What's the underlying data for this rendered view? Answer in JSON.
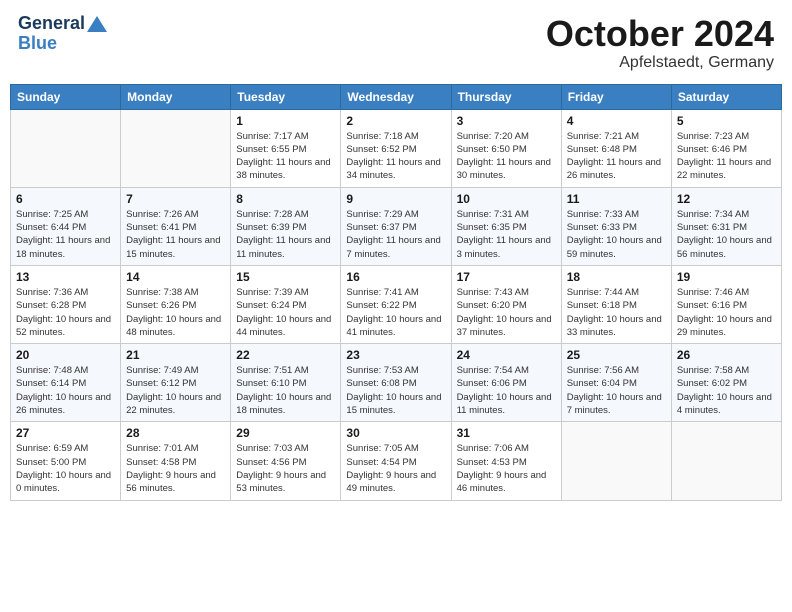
{
  "header": {
    "logo_line1": "General",
    "logo_line2": "Blue",
    "month": "October 2024",
    "location": "Apfelstaedt, Germany"
  },
  "weekdays": [
    "Sunday",
    "Monday",
    "Tuesday",
    "Wednesday",
    "Thursday",
    "Friday",
    "Saturday"
  ],
  "weeks": [
    [
      {
        "day": "",
        "info": ""
      },
      {
        "day": "",
        "info": ""
      },
      {
        "day": "1",
        "info": "Sunrise: 7:17 AM\nSunset: 6:55 PM\nDaylight: 11 hours and 38 minutes."
      },
      {
        "day": "2",
        "info": "Sunrise: 7:18 AM\nSunset: 6:52 PM\nDaylight: 11 hours and 34 minutes."
      },
      {
        "day": "3",
        "info": "Sunrise: 7:20 AM\nSunset: 6:50 PM\nDaylight: 11 hours and 30 minutes."
      },
      {
        "day": "4",
        "info": "Sunrise: 7:21 AM\nSunset: 6:48 PM\nDaylight: 11 hours and 26 minutes."
      },
      {
        "day": "5",
        "info": "Sunrise: 7:23 AM\nSunset: 6:46 PM\nDaylight: 11 hours and 22 minutes."
      }
    ],
    [
      {
        "day": "6",
        "info": "Sunrise: 7:25 AM\nSunset: 6:44 PM\nDaylight: 11 hours and 18 minutes."
      },
      {
        "day": "7",
        "info": "Sunrise: 7:26 AM\nSunset: 6:41 PM\nDaylight: 11 hours and 15 minutes."
      },
      {
        "day": "8",
        "info": "Sunrise: 7:28 AM\nSunset: 6:39 PM\nDaylight: 11 hours and 11 minutes."
      },
      {
        "day": "9",
        "info": "Sunrise: 7:29 AM\nSunset: 6:37 PM\nDaylight: 11 hours and 7 minutes."
      },
      {
        "day": "10",
        "info": "Sunrise: 7:31 AM\nSunset: 6:35 PM\nDaylight: 11 hours and 3 minutes."
      },
      {
        "day": "11",
        "info": "Sunrise: 7:33 AM\nSunset: 6:33 PM\nDaylight: 10 hours and 59 minutes."
      },
      {
        "day": "12",
        "info": "Sunrise: 7:34 AM\nSunset: 6:31 PM\nDaylight: 10 hours and 56 minutes."
      }
    ],
    [
      {
        "day": "13",
        "info": "Sunrise: 7:36 AM\nSunset: 6:28 PM\nDaylight: 10 hours and 52 minutes."
      },
      {
        "day": "14",
        "info": "Sunrise: 7:38 AM\nSunset: 6:26 PM\nDaylight: 10 hours and 48 minutes."
      },
      {
        "day": "15",
        "info": "Sunrise: 7:39 AM\nSunset: 6:24 PM\nDaylight: 10 hours and 44 minutes."
      },
      {
        "day": "16",
        "info": "Sunrise: 7:41 AM\nSunset: 6:22 PM\nDaylight: 10 hours and 41 minutes."
      },
      {
        "day": "17",
        "info": "Sunrise: 7:43 AM\nSunset: 6:20 PM\nDaylight: 10 hours and 37 minutes."
      },
      {
        "day": "18",
        "info": "Sunrise: 7:44 AM\nSunset: 6:18 PM\nDaylight: 10 hours and 33 minutes."
      },
      {
        "day": "19",
        "info": "Sunrise: 7:46 AM\nSunset: 6:16 PM\nDaylight: 10 hours and 29 minutes."
      }
    ],
    [
      {
        "day": "20",
        "info": "Sunrise: 7:48 AM\nSunset: 6:14 PM\nDaylight: 10 hours and 26 minutes."
      },
      {
        "day": "21",
        "info": "Sunrise: 7:49 AM\nSunset: 6:12 PM\nDaylight: 10 hours and 22 minutes."
      },
      {
        "day": "22",
        "info": "Sunrise: 7:51 AM\nSunset: 6:10 PM\nDaylight: 10 hours and 18 minutes."
      },
      {
        "day": "23",
        "info": "Sunrise: 7:53 AM\nSunset: 6:08 PM\nDaylight: 10 hours and 15 minutes."
      },
      {
        "day": "24",
        "info": "Sunrise: 7:54 AM\nSunset: 6:06 PM\nDaylight: 10 hours and 11 minutes."
      },
      {
        "day": "25",
        "info": "Sunrise: 7:56 AM\nSunset: 6:04 PM\nDaylight: 10 hours and 7 minutes."
      },
      {
        "day": "26",
        "info": "Sunrise: 7:58 AM\nSunset: 6:02 PM\nDaylight: 10 hours and 4 minutes."
      }
    ],
    [
      {
        "day": "27",
        "info": "Sunrise: 6:59 AM\nSunset: 5:00 PM\nDaylight: 10 hours and 0 minutes."
      },
      {
        "day": "28",
        "info": "Sunrise: 7:01 AM\nSunset: 4:58 PM\nDaylight: 9 hours and 56 minutes."
      },
      {
        "day": "29",
        "info": "Sunrise: 7:03 AM\nSunset: 4:56 PM\nDaylight: 9 hours and 53 minutes."
      },
      {
        "day": "30",
        "info": "Sunrise: 7:05 AM\nSunset: 4:54 PM\nDaylight: 9 hours and 49 minutes."
      },
      {
        "day": "31",
        "info": "Sunrise: 7:06 AM\nSunset: 4:53 PM\nDaylight: 9 hours and 46 minutes."
      },
      {
        "day": "",
        "info": ""
      },
      {
        "day": "",
        "info": ""
      }
    ]
  ]
}
